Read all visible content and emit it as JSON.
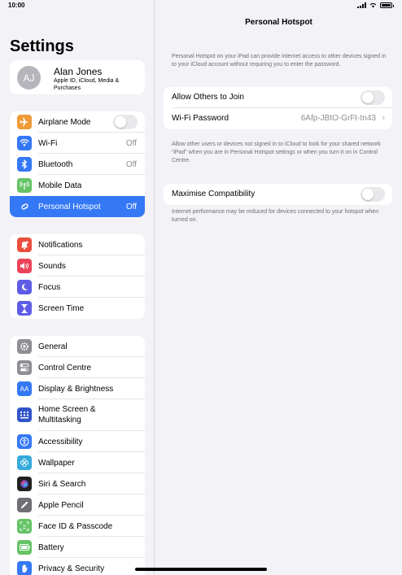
{
  "status": {
    "time": "10:00"
  },
  "sidebar": {
    "title": "Settings",
    "profile": {
      "initials": "AJ",
      "name": "Alan Jones",
      "subtitle": "Apple ID, iCloud, Media & Purchases"
    },
    "group1": [
      {
        "label": "Airplane Mode",
        "icon": "airplane-icon",
        "color": "#f09a37",
        "toggle": true
      },
      {
        "label": "Wi-Fi",
        "icon": "wifi-icon",
        "color": "#3478f6",
        "value": "Off"
      },
      {
        "label": "Bluetooth",
        "icon": "bluetooth-icon",
        "color": "#3478f6",
        "value": "Off"
      },
      {
        "label": "Mobile Data",
        "icon": "antenna-icon",
        "color": "#65c466"
      },
      {
        "label": "Personal Hotspot",
        "icon": "hotspot-icon",
        "color": "#65c466",
        "value": "Off",
        "selected": true
      }
    ],
    "group2": [
      {
        "label": "Notifications",
        "icon": "bell-icon",
        "color": "#eb4e3d"
      },
      {
        "label": "Sounds",
        "icon": "speaker-icon",
        "color": "#eb445a"
      },
      {
        "label": "Focus",
        "icon": "moon-icon",
        "color": "#5e5ce6"
      },
      {
        "label": "Screen Time",
        "icon": "hourglass-icon",
        "color": "#5e5ce6"
      }
    ],
    "group3": [
      {
        "label": "General",
        "icon": "gear-icon",
        "color": "#8e8e93"
      },
      {
        "label": "Control Centre",
        "icon": "switches-icon",
        "color": "#8e8e93"
      },
      {
        "label": "Display & Brightness",
        "icon": "text-size-icon",
        "color": "#3478f6"
      },
      {
        "label": "Home Screen & Multitasking",
        "icon": "grid-icon",
        "color": "#3155c9"
      },
      {
        "label": "Accessibility",
        "icon": "accessibility-icon",
        "color": "#3478f6"
      },
      {
        "label": "Wallpaper",
        "icon": "flower-icon",
        "color": "#35aadc"
      },
      {
        "label": "Siri & Search",
        "icon": "siri-icon",
        "color": "#222222"
      },
      {
        "label": "Apple Pencil",
        "icon": "pencil-icon",
        "color": "#6e6e73"
      },
      {
        "label": "Face ID & Passcode",
        "icon": "face-id-icon",
        "color": "#65c466"
      },
      {
        "label": "Battery",
        "icon": "battery-icon",
        "color": "#65c466"
      },
      {
        "label": "Privacy & Security",
        "icon": "hand-icon",
        "color": "#3478f6"
      }
    ]
  },
  "main": {
    "title": "Personal Hotspot",
    "intro": "Personal Hotspot on your iPad can provide internet access to other devices signed in to your iCloud account without requiring you to enter the password.",
    "allow_label": "Allow Others to Join",
    "wifi_password_label": "Wi-Fi Password",
    "wifi_password_value": "6Afp-JBtO-GrFt-tn43",
    "allow_note": "Allow other users or devices not signed in to iCloud to look for your shared network “iPad” when you are in Personal Hotspot settings or when you turn it on in Control Centre.",
    "maximise_label": "Maximise Compatibility",
    "maximise_note": "Internet performance may be reduced for devices connected to your hotspot when turned on."
  }
}
